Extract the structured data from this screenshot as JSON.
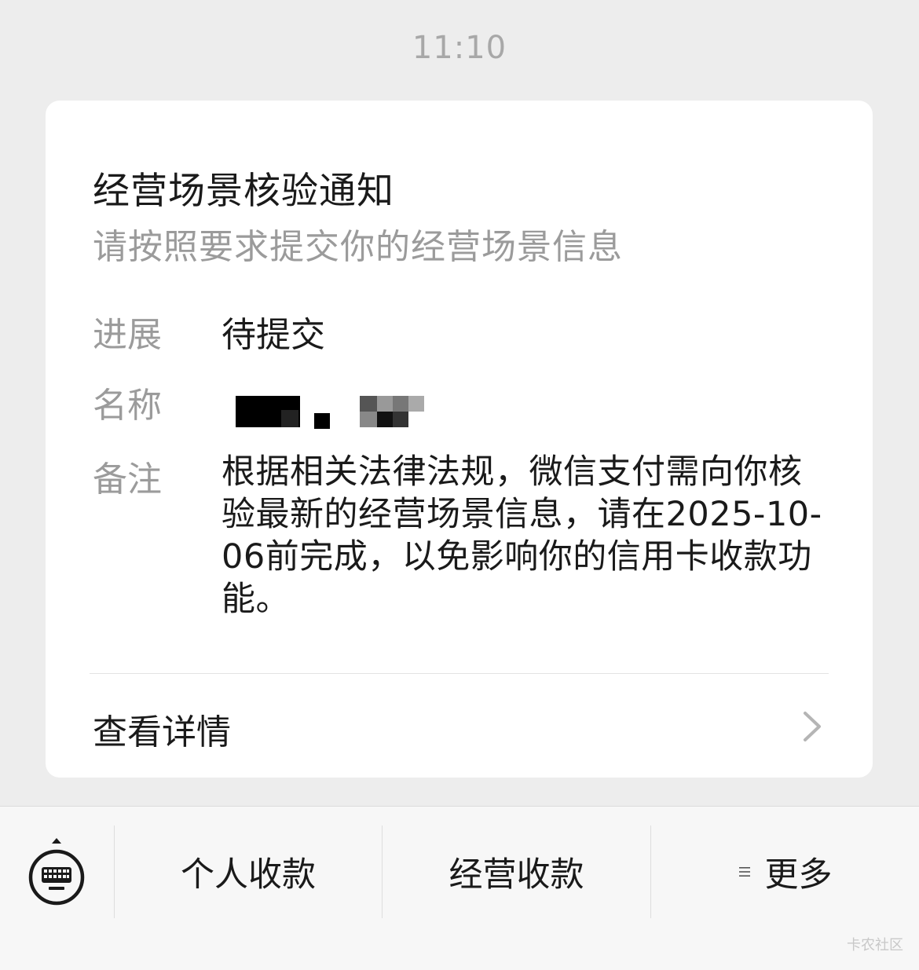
{
  "timestamp": "11:10",
  "card": {
    "title": "经营场景核验通知",
    "subtitle": "请按照要求提交你的经营场景信息",
    "fields": {
      "progress": {
        "label": "进展",
        "value": "待提交"
      },
      "name": {
        "label": "名称"
      },
      "remark": {
        "label": "备注",
        "value": "根据相关法律法规，微信支付需向你核验最新的经营场景信息，请在2025-10-06前完成，以免影响你的信用卡收款功能。"
      }
    },
    "detail_link": "查看详情"
  },
  "bottom_bar": {
    "keyboard_icon": "keyboard-icon",
    "buttons": [
      {
        "label": "个人收款"
      },
      {
        "label": "经营收款"
      },
      {
        "label": "更多",
        "icon": "menu-lines-icon"
      }
    ]
  },
  "watermark": "卡农社区",
  "colors": {
    "page_bg": "#ededed",
    "card_bg": "#ffffff",
    "text_primary": "#1a1a1a",
    "text_secondary": "#9b9b9b",
    "timestamp": "#a8a8a8"
  }
}
